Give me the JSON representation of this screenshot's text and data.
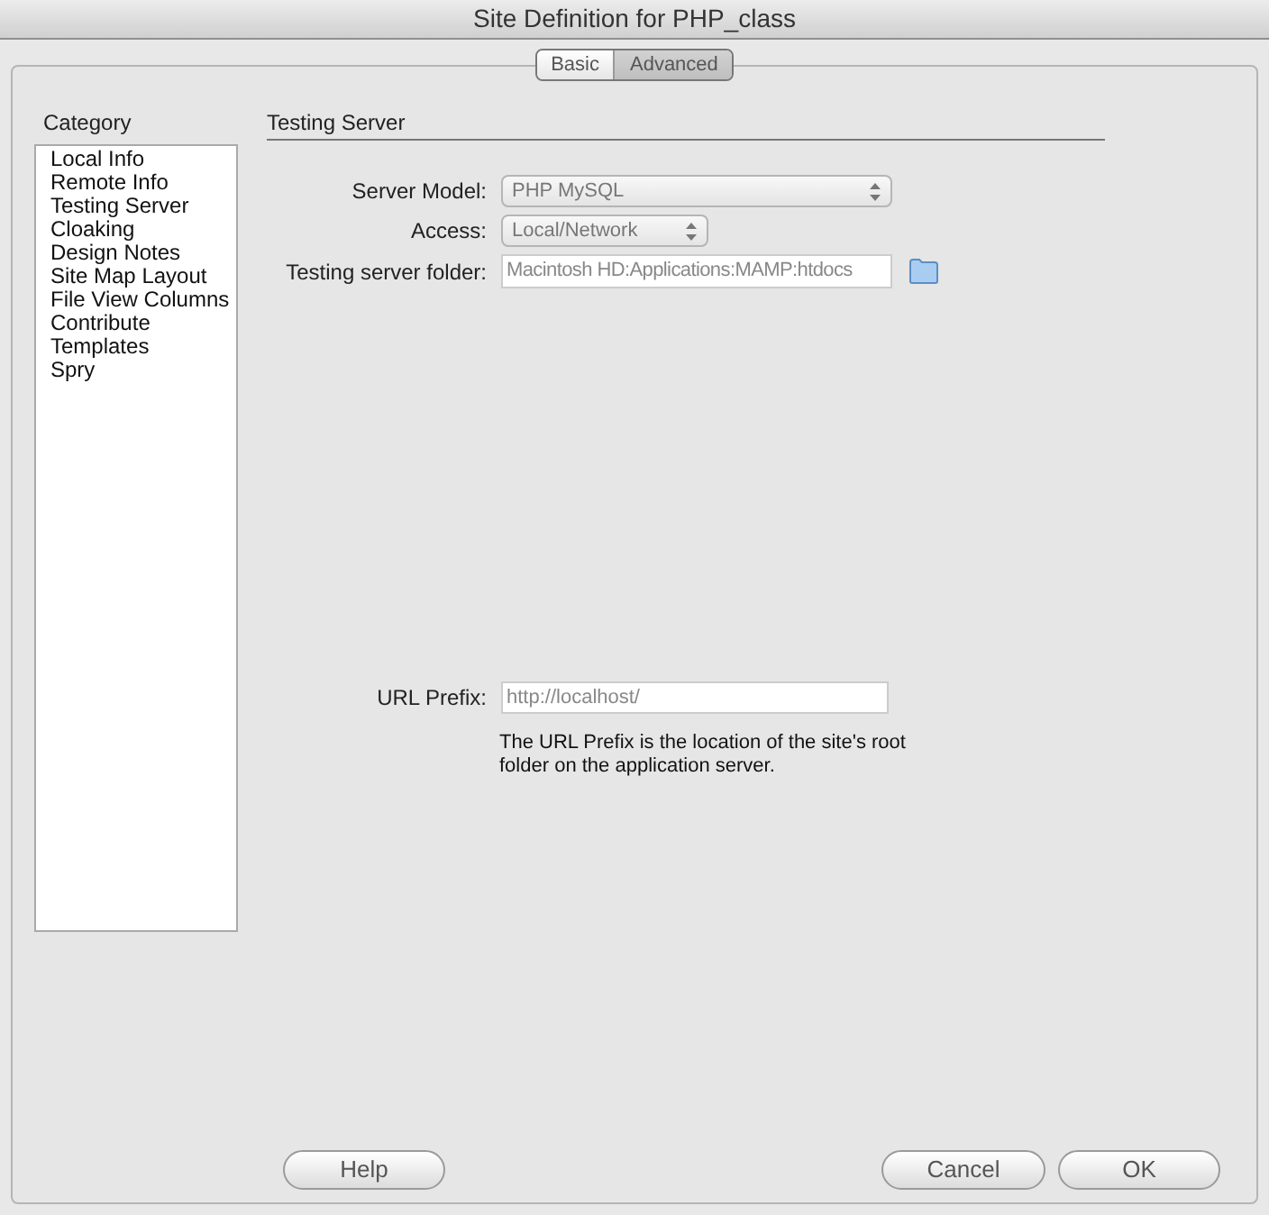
{
  "window": {
    "title": "Site Definition for PHP_class"
  },
  "tabs": [
    {
      "label": "Basic",
      "selected": false
    },
    {
      "label": "Advanced",
      "selected": true
    }
  ],
  "category": {
    "label": "Category",
    "items": [
      "Local Info",
      "Remote Info",
      "Testing Server",
      "Cloaking",
      "Design Notes",
      "Site Map Layout",
      "File View Columns",
      "Contribute",
      "Templates",
      "Spry"
    ]
  },
  "section": {
    "title": "Testing Server",
    "server_model": {
      "label": "Server Model:",
      "value": "PHP MySQL"
    },
    "access": {
      "label": "Access:",
      "value": "Local/Network"
    },
    "testing_server_folder": {
      "label": "Testing server folder:",
      "value": "Macintosh HD:Applications:MAMP:htdocs"
    },
    "url_prefix": {
      "label": "URL Prefix:",
      "value": "http://localhost/"
    },
    "description": "The URL Prefix is the location of the site's root folder on the application server."
  },
  "buttons": {
    "help": "Help",
    "cancel": "Cancel",
    "ok": "OK"
  }
}
